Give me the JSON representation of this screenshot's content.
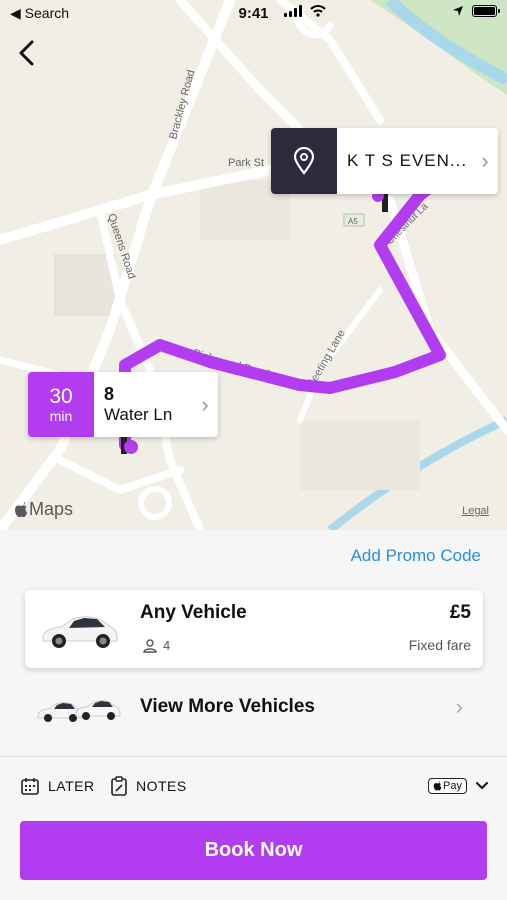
{
  "status": {
    "back_label": "◀ Search",
    "time": "9:41"
  },
  "map": {
    "streets": [
      "Brackley Road",
      "Park St",
      "Queens Road",
      "Richmond Road",
      "Meeting Lane",
      "Chestnut La",
      "A5"
    ],
    "destination": {
      "name": "K T S EVEN..."
    },
    "origin": {
      "eta_value": "30",
      "eta_unit": "min",
      "number": "8",
      "street": "Water Ln"
    },
    "maps_label": "Maps",
    "legal_label": "Legal",
    "route_color": "#b23cf0"
  },
  "booking": {
    "promo_label": "Add Promo Code",
    "vehicle": {
      "name": "Any Vehicle",
      "seats": "4",
      "price": "£5",
      "fare_type": "Fixed fare"
    },
    "more_label": "View More Vehicles",
    "later_label": "LATER",
    "notes_label": "NOTES",
    "pay_label": "Pay",
    "book_label": "Book Now"
  },
  "colors": {
    "accent": "#b23cf0",
    "link": "#2a8de0",
    "dest_pin_bg": "#2b2b3d"
  }
}
